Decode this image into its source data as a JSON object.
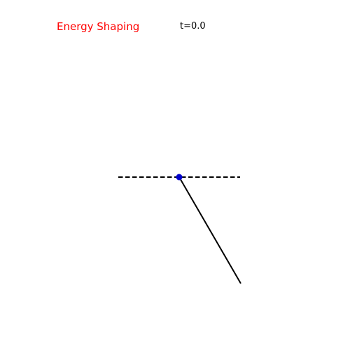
{
  "title": "Energy Shaping",
  "time_label": "t=0.0",
  "colors": {
    "title": "#ff0000",
    "time": "#000000",
    "track": "#000000",
    "pendulum_rod": "#000000",
    "pivot": "#0000cc",
    "background": "#ffffff"
  }
}
